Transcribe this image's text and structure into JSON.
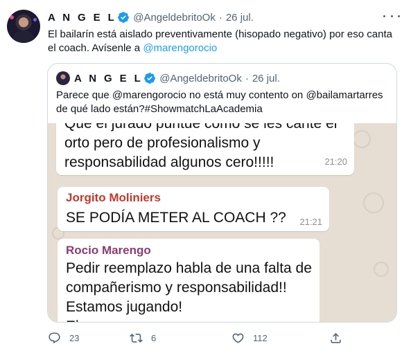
{
  "tweet": {
    "author_name": "A N G E L",
    "handle": "@AngeldebritoOk",
    "separator": "·",
    "date": "26 jul.",
    "text_line1": "El bailarín está aislado preventivamente (hisopado negativo) por eso canta",
    "text_line2": "el coach. Avísenle a ",
    "mention": "@marengorocio"
  },
  "quote": {
    "author_name": "A N G E L",
    "handle": "@AngeldebritoOk",
    "separator": "·",
    "date": "26 jul.",
    "text_line1": "Parece que @marengorocio no está muy contento on @bailamartarres",
    "text_line2": "de qué lado están?#ShowmatchLaAcademia"
  },
  "chat": {
    "bubble1": {
      "line1": "Que el jurado puntúe como se les cante el",
      "line2": "orto pero de profesionalismo y",
      "line3": "responsabilidad algunos cero!!!!!",
      "time": "21:20"
    },
    "bubble2": {
      "sender": "Jorgito Moliniers",
      "sender_color": "#c0392b",
      "message": "SE PODÍA METER AL COACH ??",
      "time": "21:21"
    },
    "bubble3": {
      "sender": "Rocio Marengo",
      "sender_color": "#8e3a6e",
      "line1": "Pedir reemplazo habla de una falta de",
      "line2": "compañerismo y responsabilidad!!",
      "line3": "Estamos jugando!",
      "line4": "El ... ... ... ... ..."
    }
  },
  "actions": {
    "reply_count": "23",
    "retweet_count": "6",
    "like_count": "112",
    "reply_icon": "reply-icon",
    "retweet_icon": "retweet-icon",
    "like_icon": "heart-icon",
    "share_icon": "share-icon"
  },
  "colors": {
    "accent": "#1d9bf0",
    "secondary_text": "#536471",
    "border": "#cfd9de",
    "chat_background": "#e6ded3"
  }
}
